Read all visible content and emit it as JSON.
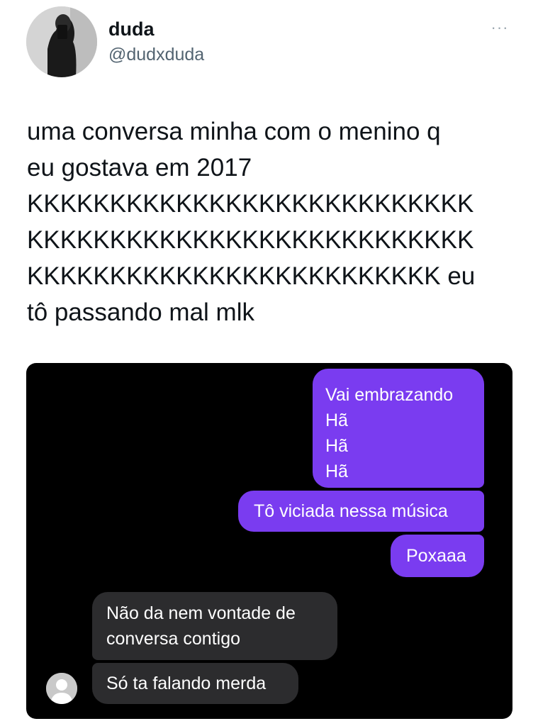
{
  "tweet": {
    "author": {
      "display_name": "duda",
      "handle": "@dudxduda"
    },
    "more_label": "···",
    "text_lines": [
      "uma conversa minha com o menino q",
      "eu gostava em 2017",
      "KKKKKKKKKKKKKKKKKKKKKKKKKKK",
      "KKKKKKKKKKKKKKKKKKKKKKKKKKK",
      "KKKKKKKKKKKKKKKKKKKKKKKKK eu",
      "tô passando mal mlk"
    ]
  },
  "chat": {
    "messages": [
      {
        "sender": "me",
        "lines": [
          "Vai embrazando",
          "Hã",
          "Hã",
          "Hã"
        ]
      },
      {
        "sender": "me",
        "lines": [
          "Tô viciada nessa música"
        ]
      },
      {
        "sender": "me",
        "lines": [
          "Poxaaa"
        ]
      },
      {
        "sender": "them",
        "lines": [
          "Não da nem vontade de",
          "conversa contigo"
        ]
      },
      {
        "sender": "them",
        "lines": [
          "Só ta falando merda"
        ]
      }
    ]
  },
  "colors": {
    "outgoing_bubble": "#7a3cf0",
    "incoming_bubble": "#2c2c2e",
    "chat_background": "#000000",
    "handle_text": "#536471"
  },
  "icons": {
    "more": "more-horizontal-icon",
    "contact_avatar": "default-user-avatar-icon"
  }
}
